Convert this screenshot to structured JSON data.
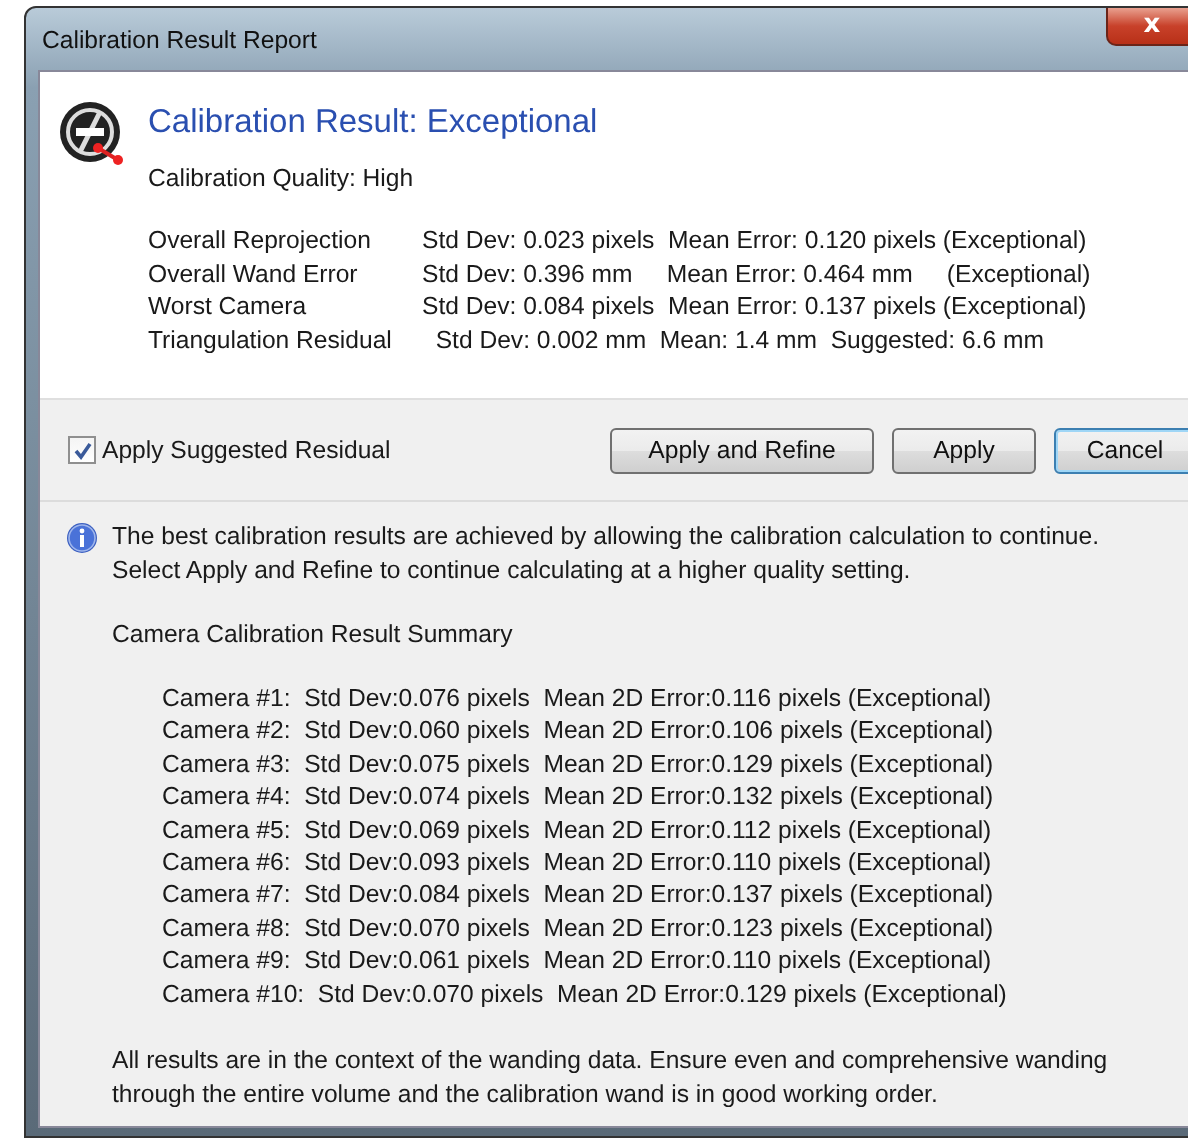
{
  "window": {
    "title": "Calibration Result Report",
    "close_label": "x"
  },
  "header": {
    "title": "Calibration Result: Exceptional",
    "quality": "Calibration Quality: High"
  },
  "metrics": [
    {
      "label": "Overall Reprojection",
      "detail": "Std Dev: 0.023 pixels  Mean Error: 0.120 pixels (Exceptional)"
    },
    {
      "label": "Overall Wand Error",
      "detail": "Std Dev: 0.396 mm     Mean Error: 0.464 mm     (Exceptional)"
    },
    {
      "label": "Worst Camera",
      "detail": "Std Dev: 0.084 pixels  Mean Error: 0.137 pixels (Exceptional)"
    },
    {
      "label": "Triangulation Residual",
      "detail": "  Std Dev: 0.002 mm  Mean: 1.4 mm  Suggested: 6.6 mm"
    }
  ],
  "checkbox": {
    "label": "Apply Suggested Residual",
    "checked": true
  },
  "buttons": [
    {
      "label": "Apply and Refine",
      "selected": false
    },
    {
      "label": "Apply",
      "selected": false
    },
    {
      "label": "Cancel",
      "selected": true
    }
  ],
  "info": "The best calibration results are achieved by allowing the calibration calculation to continue. Select Apply and Refine to continue calculating at a higher quality setting.",
  "summary_title": "Camera Calibration Result Summary",
  "cameras": [
    "Camera #1:  Std Dev:0.076 pixels  Mean 2D Error:0.116 pixels (Exceptional)",
    "Camera #2:  Std Dev:0.060 pixels  Mean 2D Error:0.106 pixels (Exceptional)",
    "Camera #3:  Std Dev:0.075 pixels  Mean 2D Error:0.129 pixels (Exceptional)",
    "Camera #4:  Std Dev:0.074 pixels  Mean 2D Error:0.132 pixels (Exceptional)",
    "Camera #5:  Std Dev:0.069 pixels  Mean 2D Error:0.112 pixels (Exceptional)",
    "Camera #6:  Std Dev:0.093 pixels  Mean 2D Error:0.110 pixels (Exceptional)",
    "Camera #7:  Std Dev:0.084 pixels  Mean 2D Error:0.137 pixels (Exceptional)",
    "Camera #8:  Std Dev:0.070 pixels  Mean 2D Error:0.123 pixels (Exceptional)",
    "Camera #9:  Std Dev:0.061 pixels  Mean 2D Error:0.110 pixels (Exceptional)",
    "Camera #10:  Std Dev:0.070 pixels  Mean 2D Error:0.129 pixels (Exceptional)"
  ],
  "footer": "All results are in the context of the wanding data.  Ensure even and comprehensive wanding through the entire volume and the calibration wand is in good working order."
}
